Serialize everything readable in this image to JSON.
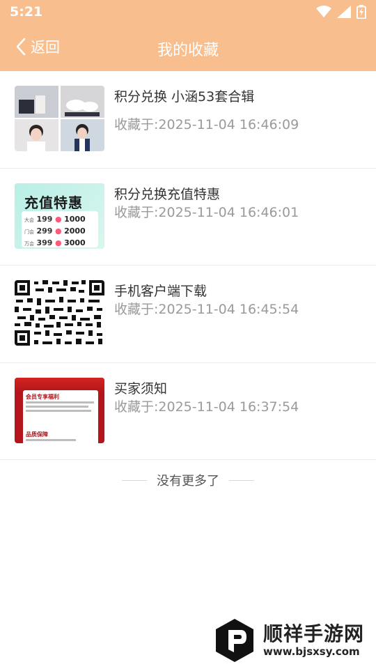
{
  "status_bar": {
    "time": "5:21"
  },
  "nav": {
    "back_label": "返回",
    "title": "我的收藏"
  },
  "favorites": [
    {
      "title": "积分兑换 小涵53套合辑",
      "time": "收藏于:2025-11-04 16:46:09",
      "thumb": "photo-collage"
    },
    {
      "title": "积分兑换充值特惠",
      "time": "收藏于:2025-11-04 16:46:01",
      "thumb": "recharge-poster",
      "poster": {
        "heading": "充值特惠",
        "rows": [
          {
            "tier": "大会",
            "price": "199",
            "points": "1000"
          },
          {
            "tier": "门会",
            "price": "299",
            "points": "2000"
          },
          {
            "tier": "万会",
            "price": "399",
            "points": "3000"
          }
        ]
      }
    },
    {
      "title": "手机客户端下载",
      "time": "收藏于:2025-11-04 16:45:54",
      "thumb": "qr-code"
    },
    {
      "title": "买家须知",
      "time": "收藏于:2025-11-04 16:37:54",
      "thumb": "notice-poster",
      "poster": {
        "line1": "会员专享福利",
        "line2": "品质保障"
      }
    }
  ],
  "end_text": "没有更多了",
  "watermark": {
    "name": "顺祥手游网",
    "url": "www.bjsxsy.com"
  },
  "colors": {
    "header": "#f9be8e",
    "title_text": "#333333",
    "time_text": "#9a9a9a"
  }
}
